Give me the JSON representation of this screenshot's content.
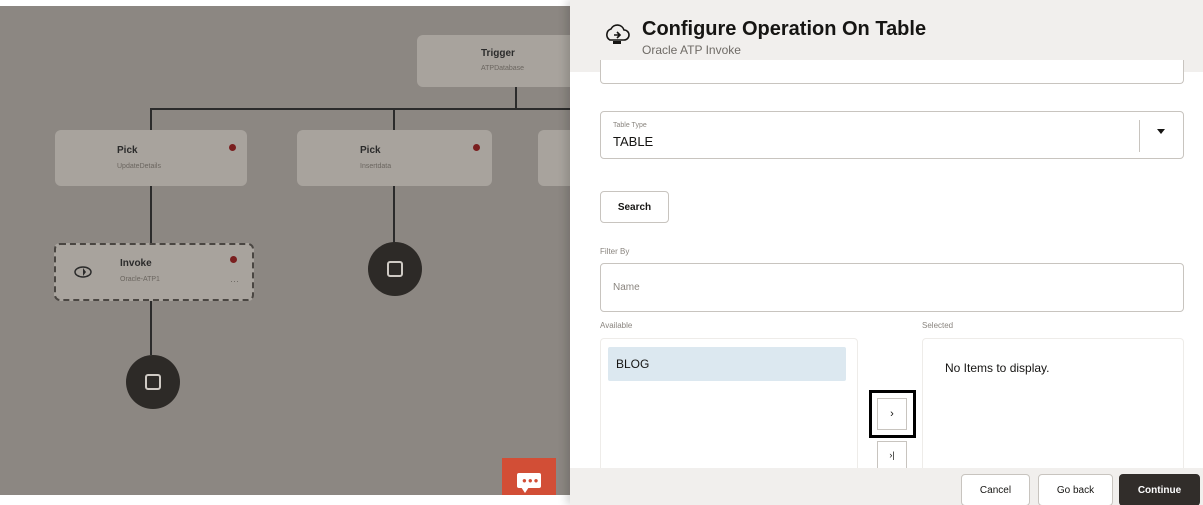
{
  "canvas": {
    "trigger": {
      "title": "Trigger",
      "sub": "ATPDatabase"
    },
    "picks": [
      {
        "title": "Pick",
        "sub": "UpdateDetails"
      },
      {
        "title": "Pick",
        "sub": "Insertdata"
      }
    ],
    "invoke": {
      "title": "Invoke",
      "sub": "Oracle-ATP1",
      "menu": "···"
    }
  },
  "panel": {
    "title": "Configure Operation On Table",
    "subtitle": "Oracle ATP Invoke",
    "table_type": {
      "label": "Table Type",
      "value": "TABLE"
    },
    "search_button": "Search",
    "filter": {
      "label": "Filter By",
      "placeholder": "Name"
    },
    "available": {
      "label": "Available",
      "items": [
        "BLOG"
      ]
    },
    "selected": {
      "label": "Selected",
      "empty_text": "No Items to display."
    },
    "move_button": "›",
    "move_all_button": "›|"
  },
  "footer": {
    "cancel": "Cancel",
    "go_back": "Go back",
    "continue": "Continue"
  },
  "colors": {
    "accent_chat": "#d24e36",
    "primary_button": "#312d2a",
    "selected_item_bg": "#dce8f0",
    "error_dot": "#7a1f1f"
  }
}
